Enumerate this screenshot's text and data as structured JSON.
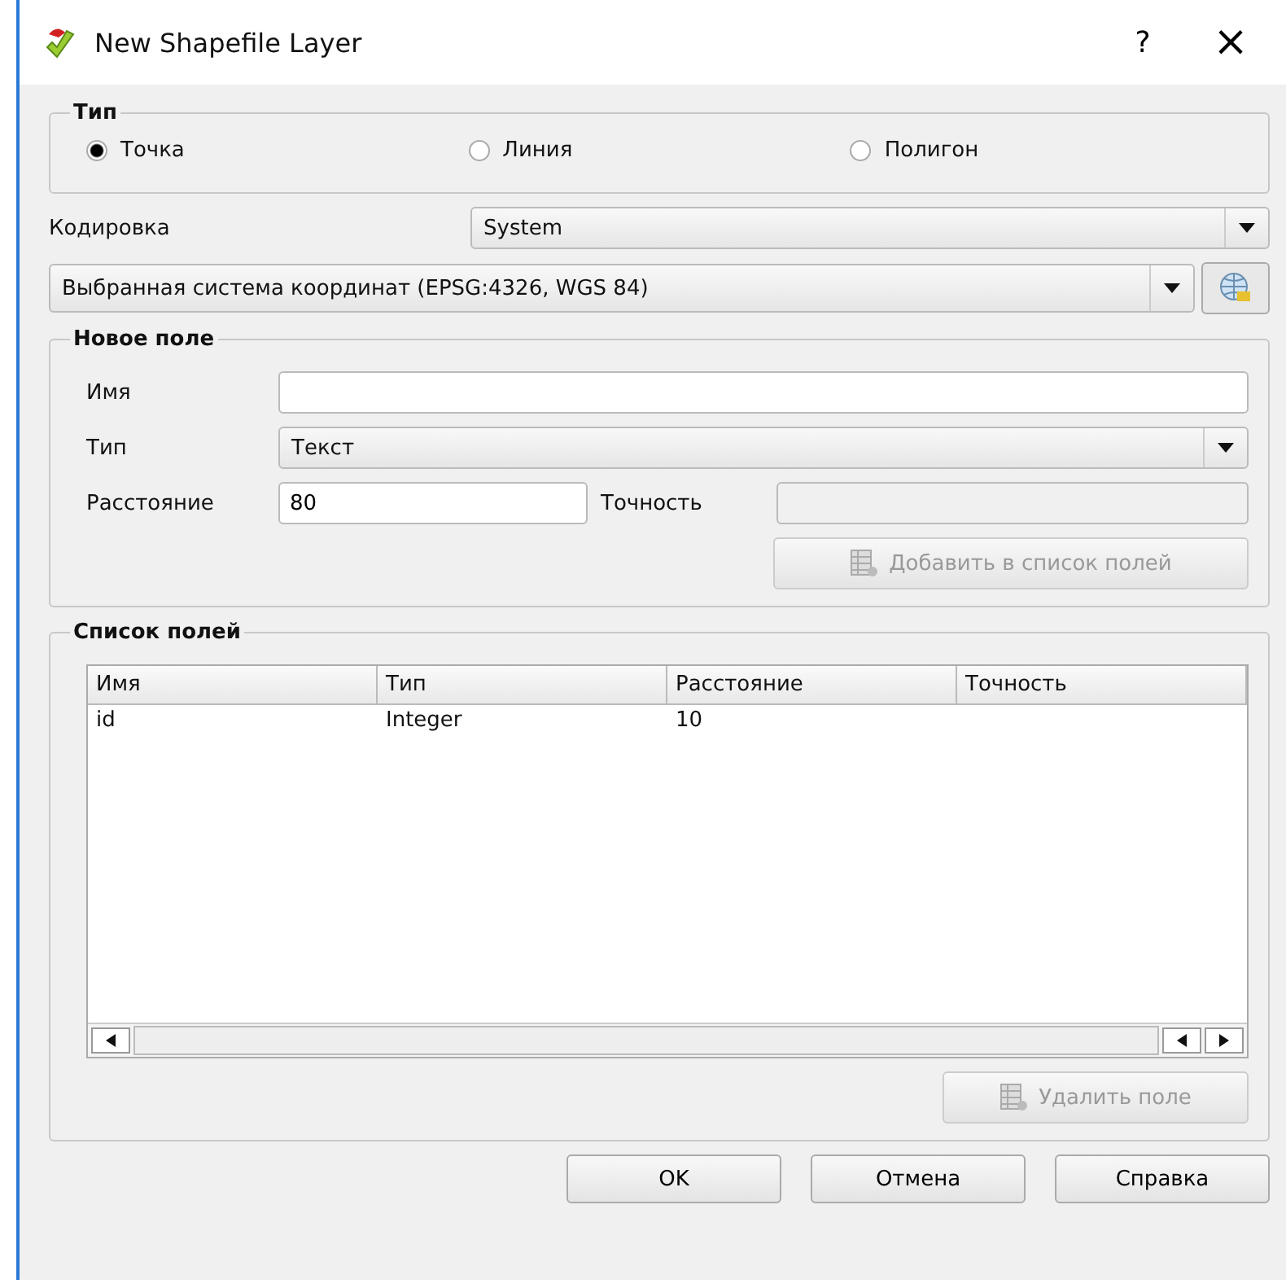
{
  "window": {
    "title": "New Shapefile Layer",
    "help": "?",
    "close": "×"
  },
  "type_group": {
    "title": "Тип",
    "options": [
      {
        "label": "Точка",
        "selected": true
      },
      {
        "label": "Линия",
        "selected": false
      },
      {
        "label": "Полигон",
        "selected": false
      }
    ]
  },
  "encoding": {
    "label": "Кодировка",
    "value": "System"
  },
  "crs": {
    "value": "Выбранная система координат (EPSG:4326, WGS 84)"
  },
  "new_field": {
    "title": "Новое поле",
    "name_label": "Имя",
    "type_label": "Тип",
    "type_value": "Текст",
    "length_label": "Расстояние",
    "length_value": "80",
    "precision_label": "Точность",
    "precision_disabled": true,
    "add_button": {
      "label": "Добавить в список полей",
      "disabled": true
    }
  },
  "field_list": {
    "title": "Список полей",
    "columns": [
      "Имя",
      "Тип",
      "Расстояние",
      "Точность"
    ],
    "rows": [
      [
        "id",
        "Integer",
        "10",
        ""
      ]
    ],
    "delete_button": {
      "label": "Удалить поле",
      "disabled": true
    }
  },
  "buttons": [
    "OK",
    "Отмена",
    "Справка"
  ]
}
